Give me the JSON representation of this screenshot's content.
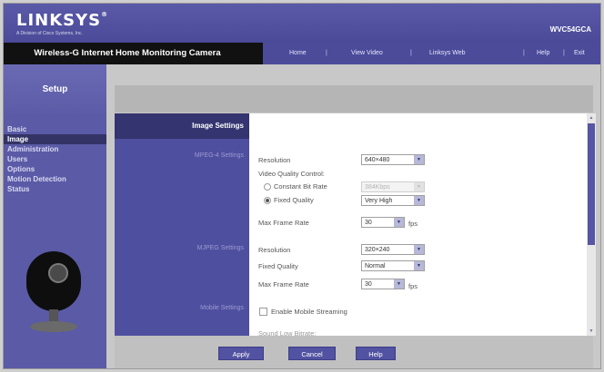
{
  "brand": {
    "logo": "LINKSYS",
    "tm": "®",
    "tagline": "A Division of Cisco Systems, Inc.",
    "model": "WVC54GCA",
    "accent": "#4b4b9a",
    "dark": "#111111"
  },
  "header": {
    "product": "Wireless-G Internet Home Monitoring Camera"
  },
  "nav": {
    "home": "Home",
    "view_video": "View Video",
    "linksys_web": "Linksys Web",
    "help": "Help",
    "exit": "Exit",
    "sep": "|"
  },
  "sidebar": {
    "title": "Setup",
    "items": [
      {
        "label": "Basic"
      },
      {
        "label": "Image"
      },
      {
        "label": "Administration"
      },
      {
        "label": "Users"
      },
      {
        "label": "Options"
      },
      {
        "label": "Motion Detection"
      },
      {
        "label": "Status"
      }
    ],
    "active_index": 1
  },
  "content": {
    "section_title": "Image Settings",
    "mpeg4_label": "MPEG-4 Settings",
    "mjpeg_label": "MJPEG Settings",
    "mobile_label": "Mobile Settings",
    "mpeg4": {
      "resolution_label": "Resolution",
      "resolution_value": "640×480",
      "vqc_label": "Video Quality Control:",
      "cbr_label": "Constant Bit Rate",
      "cbr_value": "384Kbps",
      "cbr_selected": false,
      "fq_label": "Fixed Quality",
      "fq_value": "Very High",
      "fq_selected": true,
      "mfr_label": "Max Frame Rate",
      "mfr_value": "30",
      "fps": "fps"
    },
    "mjpeg": {
      "resolution_label": "Resolution",
      "resolution_value": "320×240",
      "fq_label": "Fixed Quality",
      "fq_value": "Normal",
      "mfr_label": "Max Frame Rate",
      "mfr_value": "30",
      "fps": "fps"
    },
    "mobile": {
      "enable_label": "Enable Mobile Streaming",
      "enabled": false,
      "partial_label": "Sound Low Bitrate:"
    }
  },
  "icons": {
    "dropdown": "chevron-down-icon",
    "scroll_up": "arrow-up-icon",
    "scroll_down": "arrow-down-icon",
    "camera": "camera-image"
  },
  "buttons": {
    "apply": "Apply",
    "cancel": "Cancel",
    "help": "Help"
  }
}
